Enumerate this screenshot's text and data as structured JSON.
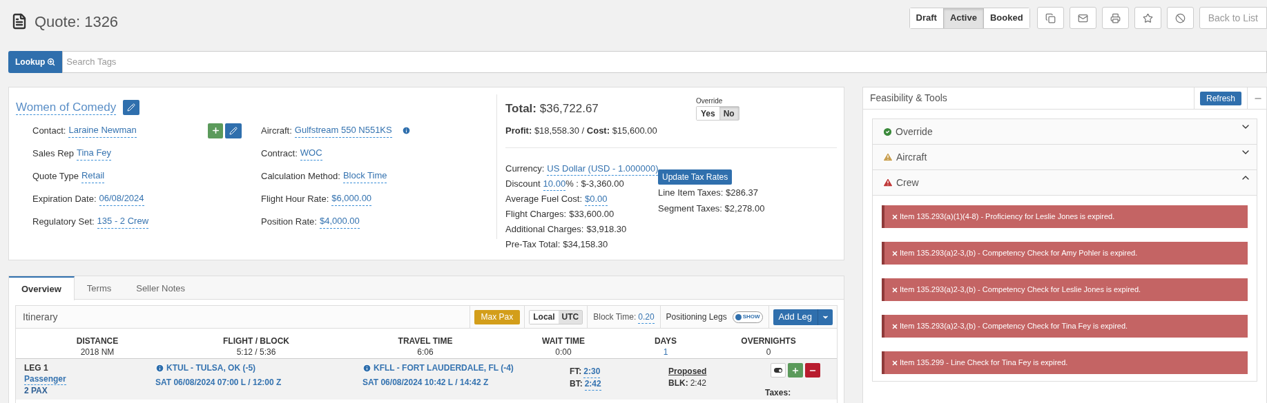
{
  "header": {
    "title": "Quote: 1326",
    "statuses": [
      {
        "label": "Draft",
        "selected": false
      },
      {
        "label": "Active",
        "selected": true
      },
      {
        "label": "Booked",
        "selected": false
      }
    ],
    "back_button": "Back to List"
  },
  "search": {
    "button": "Lookup",
    "placeholder": "Search Tags"
  },
  "trip": {
    "name": "Women of Comedy",
    "left_fields": [
      {
        "label": "Contact:",
        "value": "Laraine Newman",
        "has_buttons": true
      },
      {
        "label": "Sales Rep",
        "value": "Tina Fey",
        "has_buttons": false
      },
      {
        "label": "Quote Type",
        "value": "Retail",
        "has_buttons": false
      },
      {
        "label": "Expiration Date:",
        "value": "06/08/2024",
        "has_buttons": false
      },
      {
        "label": "Regulatory Set:",
        "value": "135 - 2 Crew",
        "has_buttons": false
      }
    ],
    "right_fields": [
      {
        "label": "Aircraft:",
        "value": "Gulfstream 550 N551KS",
        "info": true
      },
      {
        "label": "Contract:",
        "value": "WOC",
        "info": false
      },
      {
        "label": "Calculation Method:",
        "value": "Block Time",
        "info": false
      },
      {
        "label": "Flight Hour Rate:",
        "value": "$6,000.00",
        "info": false
      },
      {
        "label": "Position Rate:",
        "value": "$4,000.00",
        "info": false
      }
    ]
  },
  "totals": {
    "total": "**Total:** $36,722.67",
    "profit": "**Profit:** $18,558.30 / **Cost:** $15,600.00",
    "override": {
      "label": "Override",
      "options": [
        {
          "label": "Yes",
          "selected": false
        },
        {
          "label": "No",
          "selected": true
        }
      ]
    },
    "breakdown": [
      {
        "label": "Currency:",
        "value": "US Dollar (USD - 1.000000)",
        "linked": true
      },
      {
        "label": "Discount",
        "value": "10.00",
        "suffix": "% : $-3,360.00",
        "linked": true
      },
      {
        "label": "Average Fuel Cost:",
        "value": "$0.00",
        "linked": true
      },
      {
        "label": "Flight Charges:",
        "value": "$33,600.00",
        "linked": false
      },
      {
        "label": "Additional Charges:",
        "value": "$3,918.30",
        "linked": false
      },
      {
        "label": "Pre-Tax Total:",
        "value": "$34,158.30",
        "linked": false
      }
    ],
    "tax_button": "Update Tax Rates",
    "taxes": [
      "Line Item Taxes: $286.37",
      "Segment Taxes: $2,278.00"
    ]
  },
  "tabs": [
    {
      "label": "Overview",
      "selected": true
    },
    {
      "label": "Terms",
      "selected": false
    },
    {
      "label": "Seller Notes",
      "selected": false
    }
  ],
  "itinerary": {
    "title": "Itinerary",
    "max_pax": "Max Pax",
    "time_modes": [
      {
        "label": "Local",
        "selected": false
      },
      {
        "label": "UTC",
        "selected": true
      }
    ],
    "block_time_label": "Block Time:",
    "block_time": "0.20",
    "positioning_label": "Positioning Legs",
    "positioning_toggle": {
      "label": "SHOW",
      "on": false
    },
    "add_leg": "Add Leg",
    "summary": [
      {
        "label": "DISTANCE",
        "value": "2018 NM",
        "linked": false
      },
      {
        "label": "FLIGHT / BLOCK",
        "value": "5:12 / 5:36",
        "linked": false
      },
      {
        "label": "TRAVEL TIME",
        "value": "6:06",
        "linked": false
      },
      {
        "label": "WAIT TIME",
        "value": "0:00",
        "linked": false
      },
      {
        "label": "DAYS",
        "value": "1",
        "linked": true
      },
      {
        "label": "OVERNIGHTS",
        "value": "0",
        "linked": false
      }
    ],
    "legs": [
      {
        "label": "LEG 1",
        "type": "Passenger",
        "pax": "2 PAX",
        "departure": {
          "airport": "KTUL - TULSA, OK (-5)",
          "time": "SAT 06/08/2024 07:00 L / 12:00 Z"
        },
        "arrival": {
          "airport": "KFLL - FORT LAUDERDALE, FL (-4)",
          "time": "SAT 06/08/2024 10:42 L / 14:42 Z"
        },
        "times": [
          {
            "label": "FT:",
            "value": "2:30"
          },
          {
            "label": "BT:",
            "value": "2:42"
          }
        ],
        "status": "Proposed",
        "blk_label": "BLK:",
        "blk": "2:42",
        "taxes_label": "Taxes:"
      }
    ]
  },
  "feasibility": {
    "title": "Feasibility & Tools",
    "refresh": "Refresh",
    "sections": [
      {
        "title": "Override",
        "kind": "ok",
        "expanded": false
      },
      {
        "title": "Aircraft",
        "kind": "warning",
        "expanded": false
      },
      {
        "title": "Crew",
        "kind": "error",
        "expanded": true,
        "alerts": [
          "Item 135.293(a)(1)(4-8) - Proficiency for Leslie Jones is expired.",
          "Item 135.293(a)2-3,(b) - Competency Check for Amy Pohler is expired.",
          "Item 135.293(a)2-3,(b) - Competency Check for Leslie Jones is expired.",
          "Item 135.293(a)2-3,(b) - Competency Check for Tina Fey is expired.",
          "Item 135.299 - Line Check for Tina Fey is expired."
        ]
      }
    ]
  }
}
